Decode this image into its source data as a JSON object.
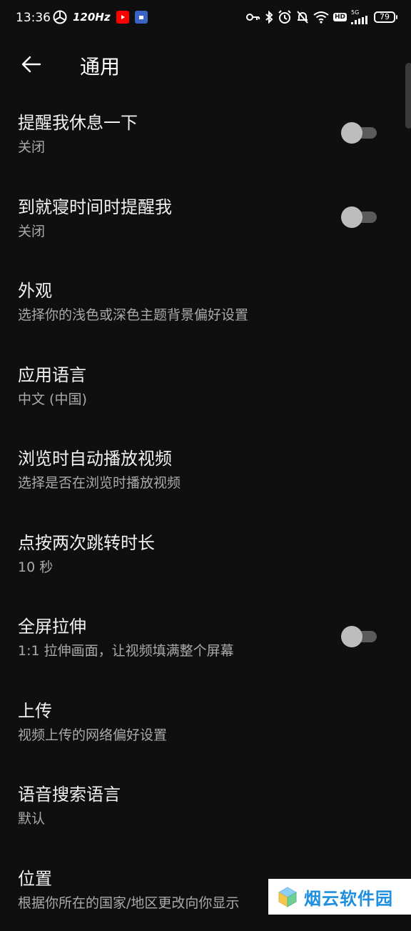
{
  "status_bar": {
    "time": "13:36",
    "refresh_rate": "120Hz",
    "network": "5G",
    "hd_badge": "HD",
    "battery": "79"
  },
  "header": {
    "title": "通用"
  },
  "settings": [
    {
      "title": "提醒我休息一下",
      "subtitle": "关闭",
      "toggle": false
    },
    {
      "title": "到就寝时间时提醒我",
      "subtitle": "关闭",
      "toggle": false
    },
    {
      "title": "外观",
      "subtitle": "选择你的浅色或深色主题背景偏好设置"
    },
    {
      "title": "应用语言",
      "subtitle": "中文 (中国)"
    },
    {
      "title": "浏览时自动播放视频",
      "subtitle": "选择是否在浏览时播放视频"
    },
    {
      "title": "点按两次跳转时长",
      "subtitle": "10 秒"
    },
    {
      "title": "全屏拉伸",
      "subtitle": "1:1 拉伸画面，让视频填满整个屏幕",
      "toggle": false
    },
    {
      "title": "上传",
      "subtitle": "视频上传的网络偏好设置"
    },
    {
      "title": "语音搜索语言",
      "subtitle": "默认"
    },
    {
      "title": "位置",
      "subtitle": "根据你所在的国家/地区更改向你显示"
    }
  ],
  "watermark": {
    "text": "烟云软件园"
  },
  "colors": {
    "background": "#0f0f0f",
    "title_text": "#f1f1f1",
    "subtitle_text": "#aaaaaa",
    "toggle_track": "#5b5b5b",
    "toggle_thumb": "#bdbdbd",
    "watermark_blue": "#1f8fe0"
  }
}
